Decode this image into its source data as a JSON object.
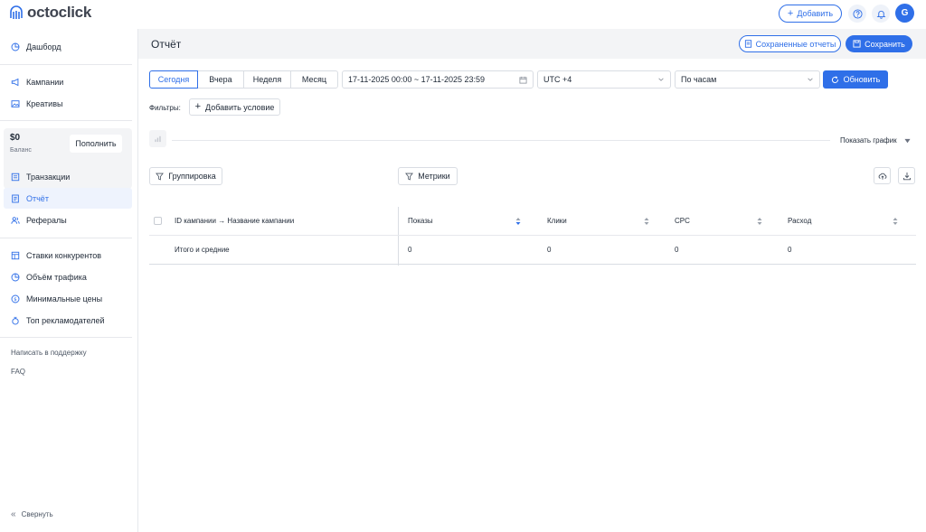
{
  "topbar": {
    "logo_text": "octoclick",
    "add_button": "Добавить",
    "avatar_letter": "G"
  },
  "sidebar": {
    "items": [
      {
        "label": "Дашборд",
        "icon": "pie-chart-icon"
      },
      {
        "label": "Кампании",
        "icon": "megaphone-icon"
      },
      {
        "label": "Креативы",
        "icon": "image-icon"
      },
      {
        "label": "Транзакции",
        "icon": "transactions-icon"
      },
      {
        "label": "Отчёт",
        "icon": "report-icon"
      },
      {
        "label": "Рефералы",
        "icon": "users-icon"
      },
      {
        "label": "Ставки конкурентов",
        "icon": "table-icon"
      },
      {
        "label": "Объём трафика",
        "icon": "pie-chart-icon"
      },
      {
        "label": "Минимальные цены",
        "icon": "dollar-circle-icon"
      },
      {
        "label": "Топ рекламодателей",
        "icon": "medal-icon"
      }
    ],
    "balance": {
      "amount": "$0",
      "label": "Баланс",
      "topup": "Пополнить"
    },
    "support": "Написать в поддержку",
    "faq": "FAQ",
    "collapse": "Свернуть"
  },
  "header": {
    "title": "Отчёт",
    "saved_reports": "Сохраненные отчеты",
    "save": "Сохранить"
  },
  "filters": {
    "periods": [
      "Сегодня",
      "Вчера",
      "Неделя",
      "Месяц"
    ],
    "active_period": "Сегодня",
    "date_range": "17-11-2025 00:00 ~ 17-11-2025 23:59",
    "timezone": "UTC +4",
    "granularity": "По часам",
    "refresh": "Обновить",
    "filters_label": "Фильтры:",
    "add_condition": "Добавить условие",
    "show_chart": "Показать график",
    "grouping": "Группировка",
    "metrics": "Метрики"
  },
  "table": {
    "columns": [
      "ID кампании → Название кампании",
      "Показы",
      "Клики",
      "CPC",
      "Расход"
    ],
    "rows": [
      [
        "Итого и средние",
        "0",
        "0",
        "0",
        "0"
      ]
    ]
  },
  "colors": {
    "accent": "#2f6fe8",
    "header_bg": "#f3f4f6",
    "border": "#d9dde3"
  }
}
